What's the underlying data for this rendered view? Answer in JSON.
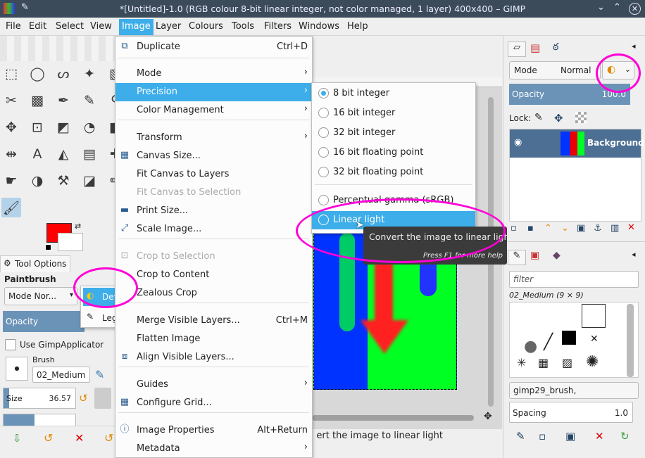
{
  "window": {
    "title": "*[Untitled]-1.0 (RGB colour 8-bit linear integer, not color managed, 1 layer) 400x400 – GIMP"
  },
  "menubar": [
    "File",
    "Edit",
    "Select",
    "View",
    "Image",
    "Layer",
    "Colours",
    "Tools",
    "Filters",
    "Windows",
    "Help"
  ],
  "image_menu": [
    {
      "label": "Duplicate",
      "acc": "Ctrl+D",
      "icon": "duplicate-icon"
    },
    {
      "label": "Mode",
      "sub": true
    },
    {
      "label": "Precision",
      "sub": true,
      "hl": true
    },
    {
      "label": "Color Management",
      "sub": true
    },
    {
      "label": "Transform",
      "sub": true
    },
    {
      "label": "Canvas Size...",
      "icon": "canvas-size-icon"
    },
    {
      "label": "Fit Canvas to Layers"
    },
    {
      "label": "Fit Canvas to Selection",
      "dis": true
    },
    {
      "label": "Print Size...",
      "icon": "print-icon"
    },
    {
      "label": "Scale Image...",
      "icon": "scale-icon"
    },
    {
      "label": "Crop to Selection",
      "dis": true,
      "icon": "crop-icon"
    },
    {
      "label": "Crop to Content"
    },
    {
      "label": "Zealous Crop"
    },
    {
      "label": "Merge Visible Layers...",
      "acc": "Ctrl+M"
    },
    {
      "label": "Flatten Image"
    },
    {
      "label": "Align Visible Layers...",
      "icon": "align-icon"
    },
    {
      "label": "Guides",
      "sub": true
    },
    {
      "label": "Configure Grid...",
      "icon": "grid-icon"
    },
    {
      "label": "Image Properties",
      "acc": "Alt+Return",
      "icon": "info-icon"
    },
    {
      "label": "Metadata",
      "sub": true
    }
  ],
  "precision_menu": [
    "8 bit integer",
    "16 bit integer",
    "32 bit integer",
    "16 bit floating point",
    "32 bit floating point",
    "Perceptual gamma (sRGB)",
    "Linear light"
  ],
  "tooltip": {
    "text": "Convert the image to linear light",
    "hint": "Press F1 for more help"
  },
  "statusbar": {
    "text": "Convert the image to linear light"
  },
  "tool_options": {
    "tab": "Tool Options",
    "tool": "Paintbrush",
    "mode": "Mode Nor...",
    "opacity": "Opacity",
    "use_applicator": "Use GimpApplicator",
    "brush_label": "Brush",
    "brush": "02_Medium",
    "size_label": "Size",
    "size": "36.57"
  },
  "blend_popup": {
    "default": "Default",
    "legacy": "Legacy"
  },
  "layers": {
    "mode_label": "Mode",
    "mode": "Normal",
    "opacity_label": "Opacity",
    "opacity": "100.0",
    "lock": "Lock:",
    "layer_name": "Background"
  },
  "brushes": {
    "filter": "filter",
    "current": "02_Medium (9 × 9)",
    "tag": "gimp29_brush,",
    "spacing_label": "Spacing",
    "spacing": "1.0"
  },
  "colors": {
    "fg": "#ff0000",
    "bg": "#ffffff",
    "accent": "#3daee9",
    "annotation": "#ff00d8"
  }
}
